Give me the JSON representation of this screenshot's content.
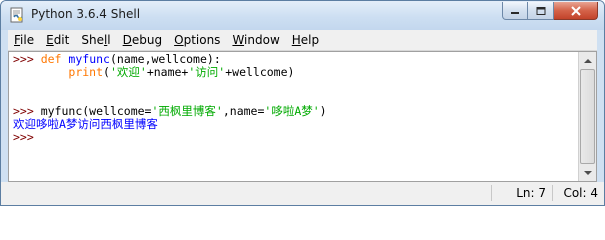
{
  "window": {
    "title": "Python 3.6.4 Shell"
  },
  "menu": {
    "items": [
      {
        "accel": "F",
        "rest": "ile",
        "name": "menu-file"
      },
      {
        "accel": "E",
        "rest": "dit",
        "name": "menu-edit"
      },
      {
        "pre": "She",
        "accel": "l",
        "rest": "l",
        "name": "menu-shell"
      },
      {
        "accel": "D",
        "rest": "ebug",
        "name": "menu-debug"
      },
      {
        "accel": "O",
        "rest": "ptions",
        "name": "menu-options"
      },
      {
        "accel": "W",
        "rest": "indow",
        "name": "menu-window"
      },
      {
        "accel": "H",
        "rest": "elp",
        "name": "menu-help"
      }
    ]
  },
  "shell": {
    "lines": [
      [
        {
          "t": ">>> ",
          "c": "prompt"
        },
        {
          "t": "def",
          "c": "kw"
        },
        {
          "t": " ",
          "c": "plain"
        },
        {
          "t": "myfunc",
          "c": "fn"
        },
        {
          "t": "(name,wellcome):",
          "c": "plain"
        }
      ],
      [
        {
          "t": "        ",
          "c": "plain"
        },
        {
          "t": "print",
          "c": "kw"
        },
        {
          "t": "(",
          "c": "plain"
        },
        {
          "t": "'欢迎'",
          "c": "str"
        },
        {
          "t": "+name+",
          "c": "plain"
        },
        {
          "t": "'访问'",
          "c": "str"
        },
        {
          "t": "+wellcome)",
          "c": "plain"
        }
      ],
      [],
      [],
      [
        {
          "t": ">>> ",
          "c": "prompt"
        },
        {
          "t": "myfunc(wellcome=",
          "c": "plain"
        },
        {
          "t": "'西枫里博客'",
          "c": "str"
        },
        {
          "t": ",name=",
          "c": "plain"
        },
        {
          "t": "'哆啦A梦'",
          "c": "str"
        },
        {
          "t": ")",
          "c": "plain"
        }
      ],
      [
        {
          "t": "欢迎哆啦A梦访问西枫里博客",
          "c": "out"
        }
      ],
      [
        {
          "t": ">>> ",
          "c": "prompt"
        }
      ]
    ]
  },
  "status": {
    "ln": "Ln: 7",
    "col": "Col: 4"
  },
  "icons": {
    "app": "python-idle-icon",
    "minimize": "minimize-icon",
    "maximize": "maximize-icon",
    "close": "close-icon"
  }
}
